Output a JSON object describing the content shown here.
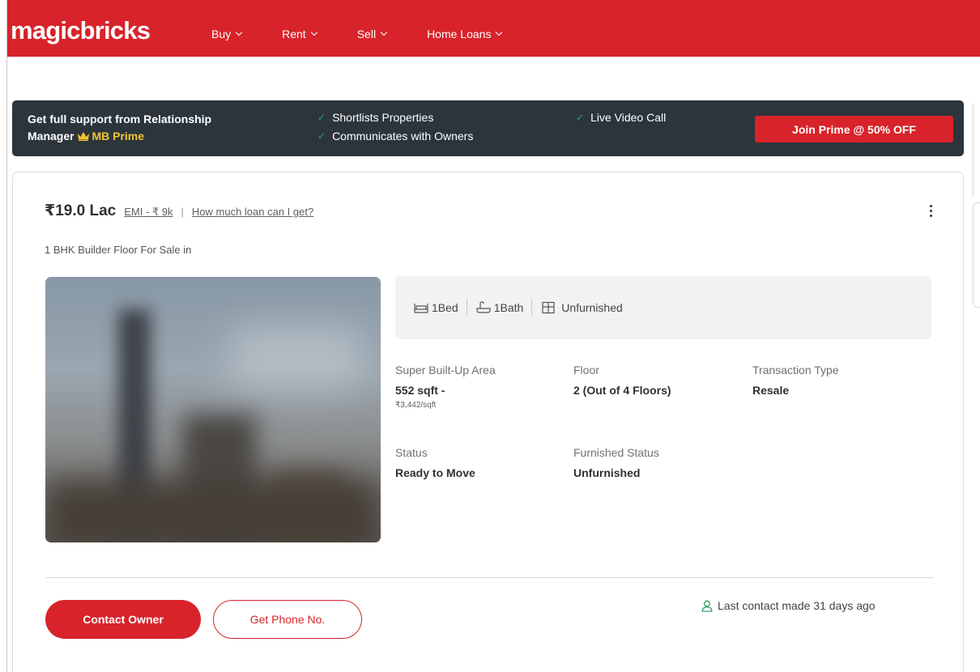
{
  "header": {
    "logo": "magicbricks",
    "nav": [
      {
        "label": "Buy"
      },
      {
        "label": "Rent"
      },
      {
        "label": "Sell"
      },
      {
        "label": "Home Loans"
      }
    ]
  },
  "prime_banner": {
    "title_line1": "Get full support from Relationship",
    "title_line2": "Manager",
    "prime_label": "MB Prime",
    "features": [
      "Shortlists Properties",
      "Communicates with Owners",
      "Live Video Call"
    ],
    "cta": "Join Prime @ 50% OFF",
    "colors": {
      "background": "#2c353c",
      "tick": "#2aa36b",
      "gold": "#f4c430"
    }
  },
  "listing": {
    "price": "₹19.0 Lac",
    "emi": "EMI - ₹ 9k",
    "separator": "|",
    "loan_link": "How much loan can I get?",
    "title": "1 BHK Builder Floor For Sale in",
    "summary": {
      "bed": "1Bed",
      "bath": "1Bath",
      "furnishing": "Unfurnished"
    },
    "attributes": {
      "area_label": "Super Built-Up Area",
      "area_value": "552 sqft -",
      "area_rate": "₹3,442/sqft",
      "floor_label": "Floor",
      "floor_value": "2 (Out of 4 Floors)",
      "transaction_label": "Transaction Type",
      "transaction_value": "Resale",
      "status_label": "Status",
      "status_value": "Ready to Move",
      "furnished_label": "Furnished Status",
      "furnished_value": "Unfurnished"
    },
    "actions": {
      "contact": "Contact Owner",
      "phone": "Get Phone No."
    },
    "last_contact": "Last contact made 31 days ago"
  },
  "colors": {
    "brand": "#d8232a",
    "summary_bg": "#f1f2f3",
    "contact_icon": "#2aa36b"
  }
}
